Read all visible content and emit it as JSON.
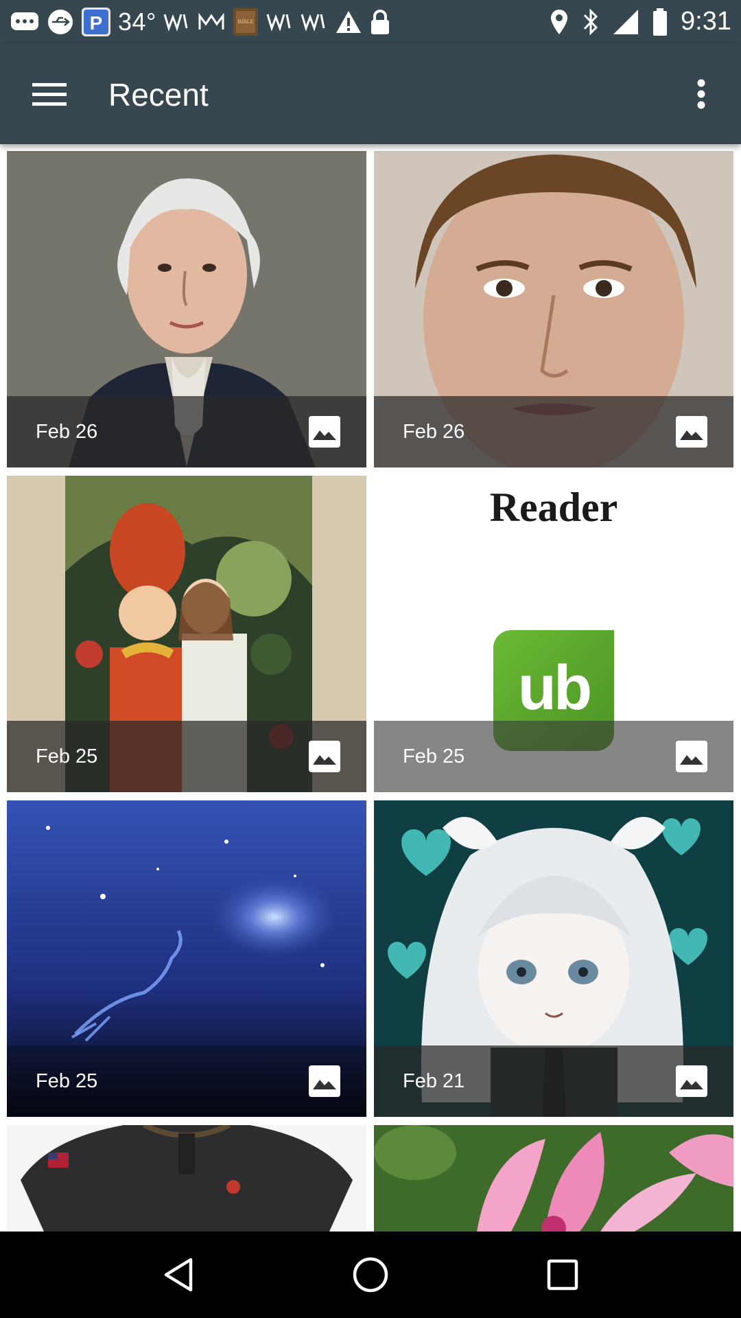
{
  "status_bar": {
    "temperature": "34°",
    "time": "9:31"
  },
  "app_bar": {
    "title": "Recent"
  },
  "tiles": [
    {
      "date": "Feb 26",
      "subject": "portrait of man in white wig"
    },
    {
      "date": "Feb 26",
      "subject": "portrait of young face"
    },
    {
      "date": "Feb 25",
      "subject": "illustrated storybook characters"
    },
    {
      "date": "Feb 25",
      "subject": "reader logo",
      "logo_text": "Reader",
      "logo_mark": "ub"
    },
    {
      "date": "Feb 25",
      "subject": "night sky constellation map"
    },
    {
      "date": "Feb 21",
      "subject": "anime girl with hearts"
    },
    {
      "date": "",
      "subject": "black polo shirt"
    },
    {
      "date": "",
      "subject": "pink flowers"
    }
  ],
  "colors": {
    "app_bar": "#37474f",
    "caption_overlay": "rgba(40,40,40,0.72)",
    "logo_green": "#5aa02c"
  }
}
